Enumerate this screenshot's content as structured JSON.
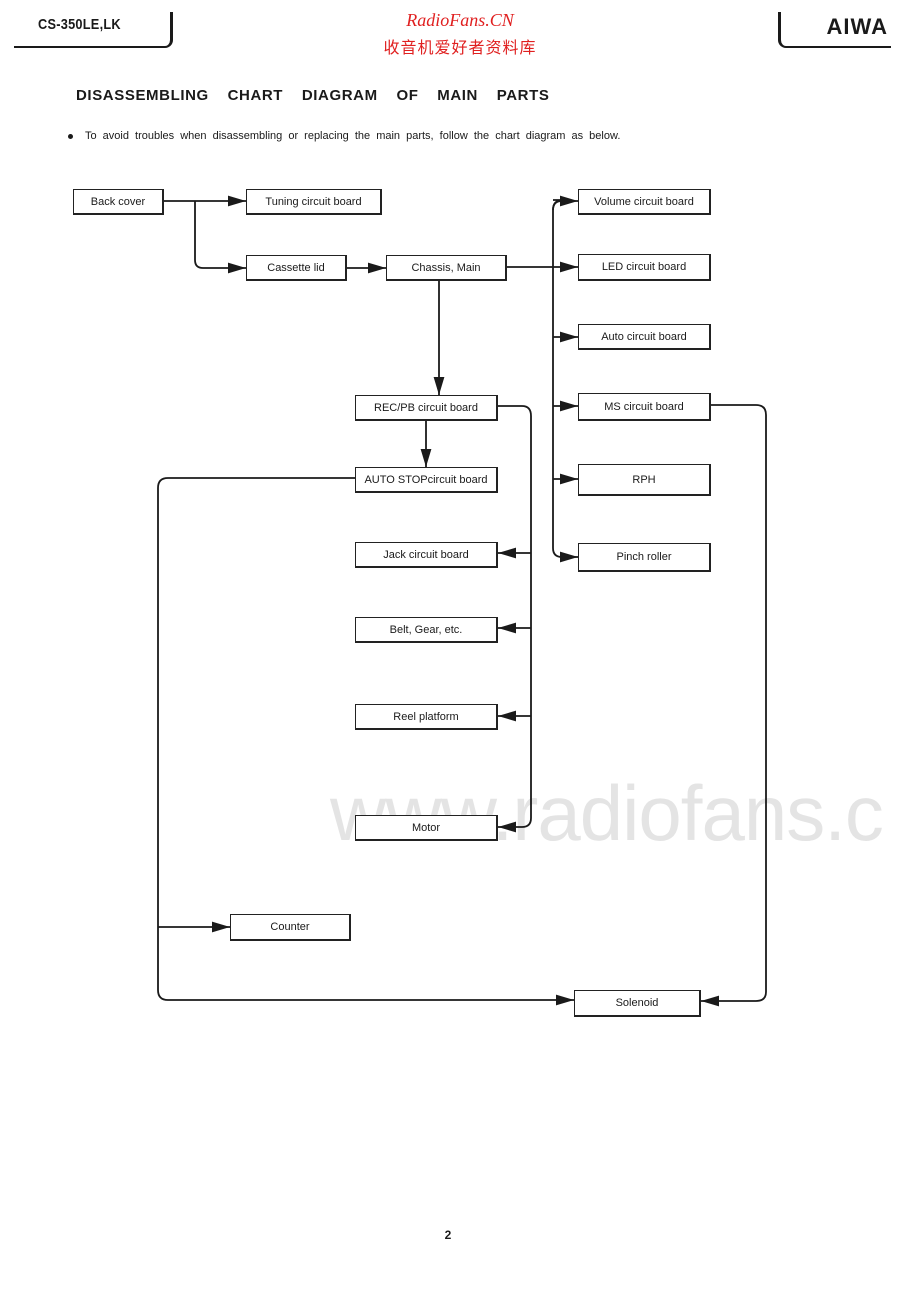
{
  "header": {
    "model": "CS-350LE,LK",
    "brand": "AIWA",
    "watermark_title": "RadioFans.CN",
    "watermark_subtitle": "收音机爱好者资料库"
  },
  "page": {
    "heading": "DISASSEMBLING CHART DIAGRAM OF MAIN PARTS",
    "note": "To avoid troubles when disassembling or replacing the main parts, follow the chart diagram as below.",
    "page_number": "2",
    "watermark_url": "www.radiofans.c"
  },
  "diagram": {
    "nodes": {
      "back_cover": "Back cover",
      "tuning": "Tuning circuit board",
      "cassette_lid": "Cassette lid",
      "chassis": "Chassis, Main",
      "volume": "Volume circuit board",
      "led": "LED circuit board",
      "auto": "Auto circuit board",
      "ms": "MS circuit board",
      "rph": "RPH",
      "pinch": "Pinch roller",
      "recpb": "REC/PB circuit board",
      "autostop": "AUTO STOPcircuit board",
      "jack": "Jack circuit board",
      "belt": "Belt, Gear, etc.",
      "reel": "Reel platform",
      "motor": "Motor",
      "counter": "Counter",
      "solenoid": "Solenoid"
    },
    "edges": [
      [
        "back_cover",
        "tuning"
      ],
      [
        "back_cover",
        "cassette_lid"
      ],
      [
        "cassette_lid",
        "chassis"
      ],
      [
        "chassis",
        "volume"
      ],
      [
        "chassis",
        "led"
      ],
      [
        "chassis",
        "auto"
      ],
      [
        "chassis",
        "ms"
      ],
      [
        "chassis",
        "rph"
      ],
      [
        "chassis",
        "pinch"
      ],
      [
        "chassis",
        "recpb"
      ],
      [
        "recpb",
        "autostop"
      ],
      [
        "recpb",
        "jack"
      ],
      [
        "recpb",
        "belt"
      ],
      [
        "recpb",
        "reel"
      ],
      [
        "recpb",
        "motor"
      ],
      [
        "autostop",
        "counter"
      ],
      [
        "autostop",
        "solenoid"
      ],
      [
        "ms",
        "solenoid"
      ]
    ]
  }
}
